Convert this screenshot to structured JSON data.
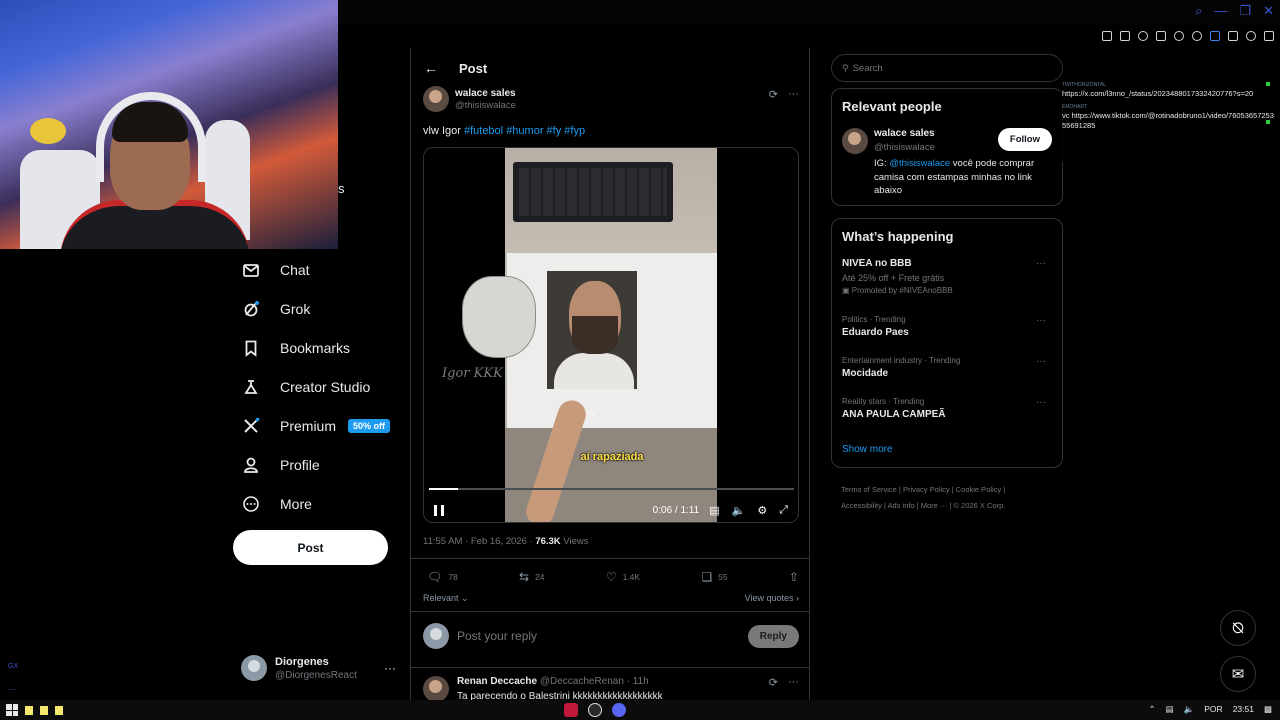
{
  "browser": {
    "window_controls": [
      "⌕",
      "—",
      "❐",
      "✕"
    ]
  },
  "sidebar": {
    "partial_text": "s",
    "items": [
      {
        "label": "Chat",
        "icon": "envelope-icon"
      },
      {
        "label": "Grok",
        "icon": "grok-icon"
      },
      {
        "label": "Bookmarks",
        "icon": "bookmark-icon"
      },
      {
        "label": "Creator Studio",
        "icon": "creator-studio-icon"
      },
      {
        "label": "Premium",
        "icon": "x-logo-icon",
        "badge": "50% off"
      },
      {
        "label": "Profile",
        "icon": "person-icon"
      },
      {
        "label": "More",
        "icon": "more-circle-icon"
      }
    ],
    "post_button": "Post",
    "account": {
      "name": "Diorgenes",
      "handle": "@DiorgenesReact"
    }
  },
  "main": {
    "title": "Post",
    "author": {
      "name": "walace sales",
      "handle": "@thisiswalace"
    },
    "text_prefix": "vlw Igor ",
    "hashtags": [
      "#futebol",
      "#humor",
      "#fy",
      "#fyp"
    ],
    "video": {
      "caption": "aí rapaziada",
      "signature": "Igor KKK",
      "time": "0:06 / 1:11",
      "progress": 0.08
    },
    "meta": {
      "time": "11:55 AM · Feb 16, 2026 · ",
      "views_count": "76.3K",
      "views_label": " Views"
    },
    "engagement": {
      "replies": "78",
      "reposts": "24",
      "likes": "1.4K",
      "bookmarks": "55"
    },
    "sort_label": "Relevant",
    "view_quotes": "View quotes",
    "reply_placeholder": "Post your reply",
    "reply_button": "Reply",
    "first_reply": {
      "name": "Renan Deccache",
      "handle_time": "@DeccacheRenan · 11h",
      "text": "Ta parecendo o Balestrini kkkkkkkkkkkkkkkkkk"
    }
  },
  "right": {
    "search_placeholder": "Search",
    "relevant_people": {
      "heading": "Relevant people",
      "person": {
        "name": "walace sales",
        "handle": "@thisiswalace",
        "follow_label": "Follow",
        "bio_prefix": "IG: ",
        "bio_mention": "@thisiswalace",
        "bio_rest": " você pode comprar camisa com estampas minhas no link abaixo"
      }
    },
    "happening": {
      "heading": "What’s happening",
      "trends": [
        {
          "category": "",
          "title": "NIVEA no BBB",
          "sub": "Até 25% off + Frete grátis",
          "promo": "Promoted by #NIVEAnoBBB"
        },
        {
          "category": "Politics · Trending",
          "title": "Eduardo Paes"
        },
        {
          "category": "Entertainment industry · Trending",
          "title": "Mocidade"
        },
        {
          "category": "Reality stars · Trending",
          "title": "ANA PAULA CAMPEÃ"
        }
      ],
      "show_more": "Show more"
    },
    "footer": {
      "line1": "Terms of Service  |  Privacy Policy  |  Cookie Policy  |",
      "line2": "Accessibility  |  Ads info  |  More ···  |  © 2026 X Corp."
    }
  },
  "notes": [
    {
      "tag": "TWITHORIZONTAL",
      "text": "https://x.com/l3nno_/status/2023488017332420776?s=20"
    },
    {
      "tag": "EMOHART",
      "text": "vc https://www.tiktok.com/@rotinadobruno1/video/7605365725355691285"
    }
  ],
  "taskbar": {
    "left_labels": [
      "GX",
      "..."
    ],
    "tray_lang": "POR",
    "tray_time": "23:51"
  }
}
